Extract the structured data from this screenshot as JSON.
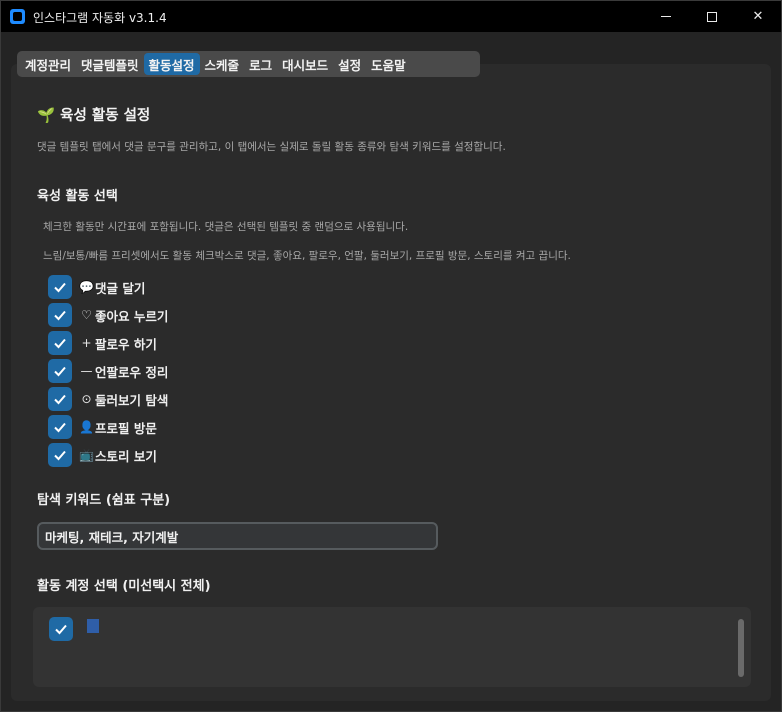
{
  "window": {
    "title": "인스타그램 자동화 v3.1.4"
  },
  "tabs": [
    {
      "label": "계정관리",
      "active": false
    },
    {
      "label": "댓글템플릿",
      "active": false
    },
    {
      "label": "활동설정",
      "active": true
    },
    {
      "label": "스케줄",
      "active": false
    },
    {
      "label": "로그",
      "active": false
    },
    {
      "label": "대시보드",
      "active": false
    },
    {
      "label": "설정",
      "active": false
    },
    {
      "label": "도움말",
      "active": false
    }
  ],
  "main": {
    "title_icon": "🌱",
    "title": "육성 활동 설정",
    "description": "댓글 템플릿 탭에서 댓글 문구를 관리하고, 이 탭에서는 실제로 돌릴 활동 종류와 탐색 키워드를 설정합니다.",
    "activity_section": {
      "title": "육성 활동 선택",
      "note1": "체크한 활동만 시간표에 포함됩니다. 댓글은 선택된 템플릿 중 랜덤으로 사용됩니다.",
      "note2": "느림/보통/빠름 프리셋에서도 활동 체크박스로 댓글, 좋아요, 팔로우, 언팔, 둘러보기, 프로필 방문, 스토리를 켜고 끕니다.",
      "items": [
        {
          "icon": "💬",
          "icon_name": "speech-bubble-icon",
          "label": "댓글 달기",
          "checked": true
        },
        {
          "icon": "♡",
          "icon_name": "heart-icon",
          "label": "좋아요 누르기",
          "checked": true
        },
        {
          "icon": "+",
          "icon_name": "plus-icon",
          "label": "팔로우 하기",
          "checked": true
        },
        {
          "icon": "—",
          "icon_name": "minus-icon",
          "label": "언팔로우 정리",
          "checked": true
        },
        {
          "icon": "⊙",
          "icon_name": "explore-icon",
          "label": "둘러보기 탐색",
          "checked": true
        },
        {
          "icon": "👤",
          "icon_name": "profile-icon",
          "label": "프로필 방문",
          "checked": true
        },
        {
          "icon": "📺",
          "icon_name": "story-icon",
          "label": "스토리 보기",
          "checked": true
        }
      ]
    },
    "keywords": {
      "label": "탐색 키워드 (쉼표 구분)",
      "value": "마케팅, 재테크, 자기계발"
    },
    "accounts": {
      "label": "활동 계정 선택 (미선택시 전체)",
      "first_checked": true
    }
  },
  "colors": {
    "accent": "#1f6aa5",
    "background": "#242424",
    "panel": "#2b2b2b",
    "input_bg": "#343638"
  }
}
